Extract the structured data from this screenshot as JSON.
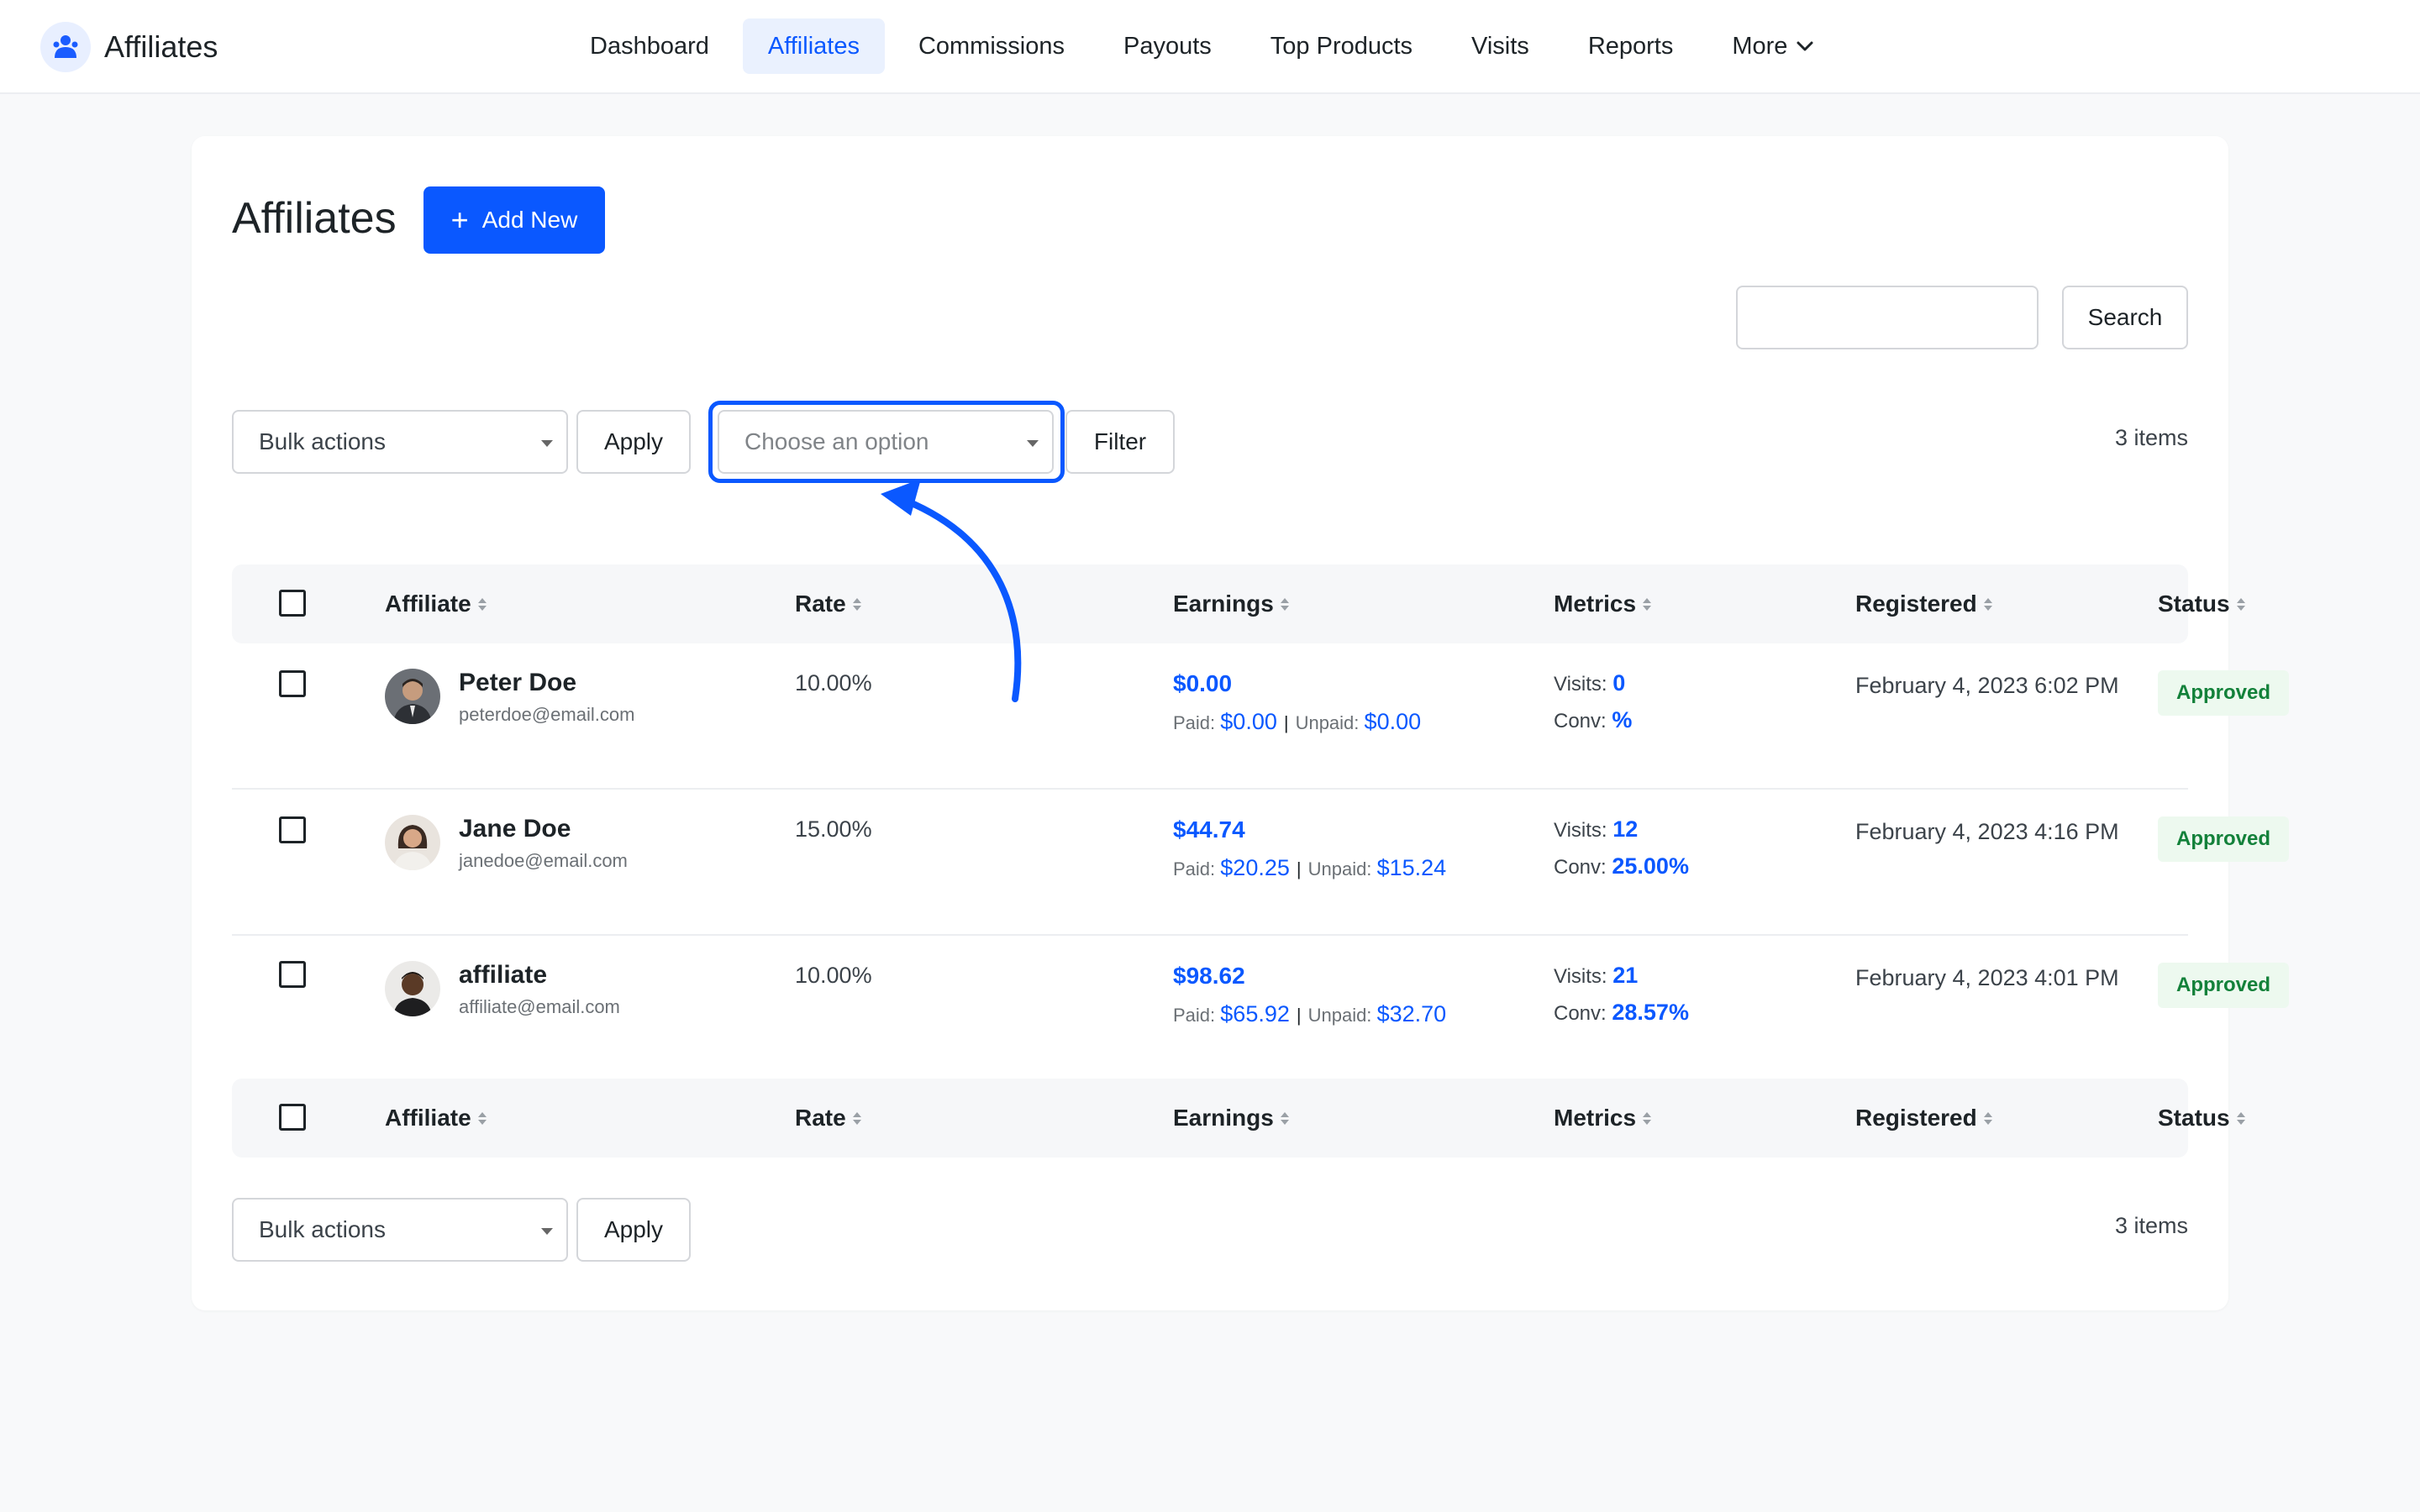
{
  "app": {
    "title": "Affiliates",
    "accent_color": "#0a58ff",
    "logo_icon": "affiliates-logo-icon"
  },
  "nav": {
    "items": [
      {
        "label": "Dashboard",
        "active": false
      },
      {
        "label": "Affiliates",
        "active": true
      },
      {
        "label": "Commissions",
        "active": false
      },
      {
        "label": "Payouts",
        "active": false
      },
      {
        "label": "Top Products",
        "active": false
      },
      {
        "label": "Visits",
        "active": false
      },
      {
        "label": "Reports",
        "active": false
      },
      {
        "label": "More",
        "active": false,
        "icon": "chevron-down-icon"
      }
    ]
  },
  "page": {
    "title": "Affiliates",
    "add_new_label": "Add New",
    "search": {
      "value": "",
      "button_label": "Search"
    },
    "bulk_actions": {
      "selected": "Bulk actions",
      "apply_label": "Apply"
    },
    "filter": {
      "placeholder": "Choose an option",
      "button_label": "Filter",
      "highlighted": true
    },
    "items_count": "3 items"
  },
  "table": {
    "columns": [
      "Affiliate",
      "Rate",
      "Earnings",
      "Metrics",
      "Registered",
      "Status"
    ],
    "labels": {
      "paid": "Paid:",
      "unpaid": "Unpaid:",
      "visits": "Visits:",
      "conv": "Conv:"
    },
    "rows": [
      {
        "name": "Peter Doe",
        "email": "peterdoe@email.com",
        "rate": "10.00%",
        "earnings": "$0.00",
        "paid": "$0.00",
        "unpaid": "$0.00",
        "visits": "0",
        "conv": "%",
        "registered": "February 4, 2023 6:02 PM",
        "status": "Approved"
      },
      {
        "name": "Jane Doe",
        "email": "janedoe@email.com",
        "rate": "15.00%",
        "earnings": "$44.74",
        "paid": "$20.25",
        "unpaid": "$15.24",
        "visits": "12",
        "conv": "25.00%",
        "registered": "February 4, 2023 4:16 PM",
        "status": "Approved"
      },
      {
        "name": "affiliate",
        "email": "affiliate@email.com",
        "rate": "10.00%",
        "earnings": "$98.62",
        "paid": "$65.92",
        "unpaid": "$32.70",
        "visits": "21",
        "conv": "28.57%",
        "registered": "February 4, 2023 4:01 PM",
        "status": "Approved"
      }
    ]
  },
  "footer": {
    "bulk_actions": {
      "selected": "Bulk actions",
      "apply_label": "Apply"
    },
    "items_count": "3 items"
  }
}
